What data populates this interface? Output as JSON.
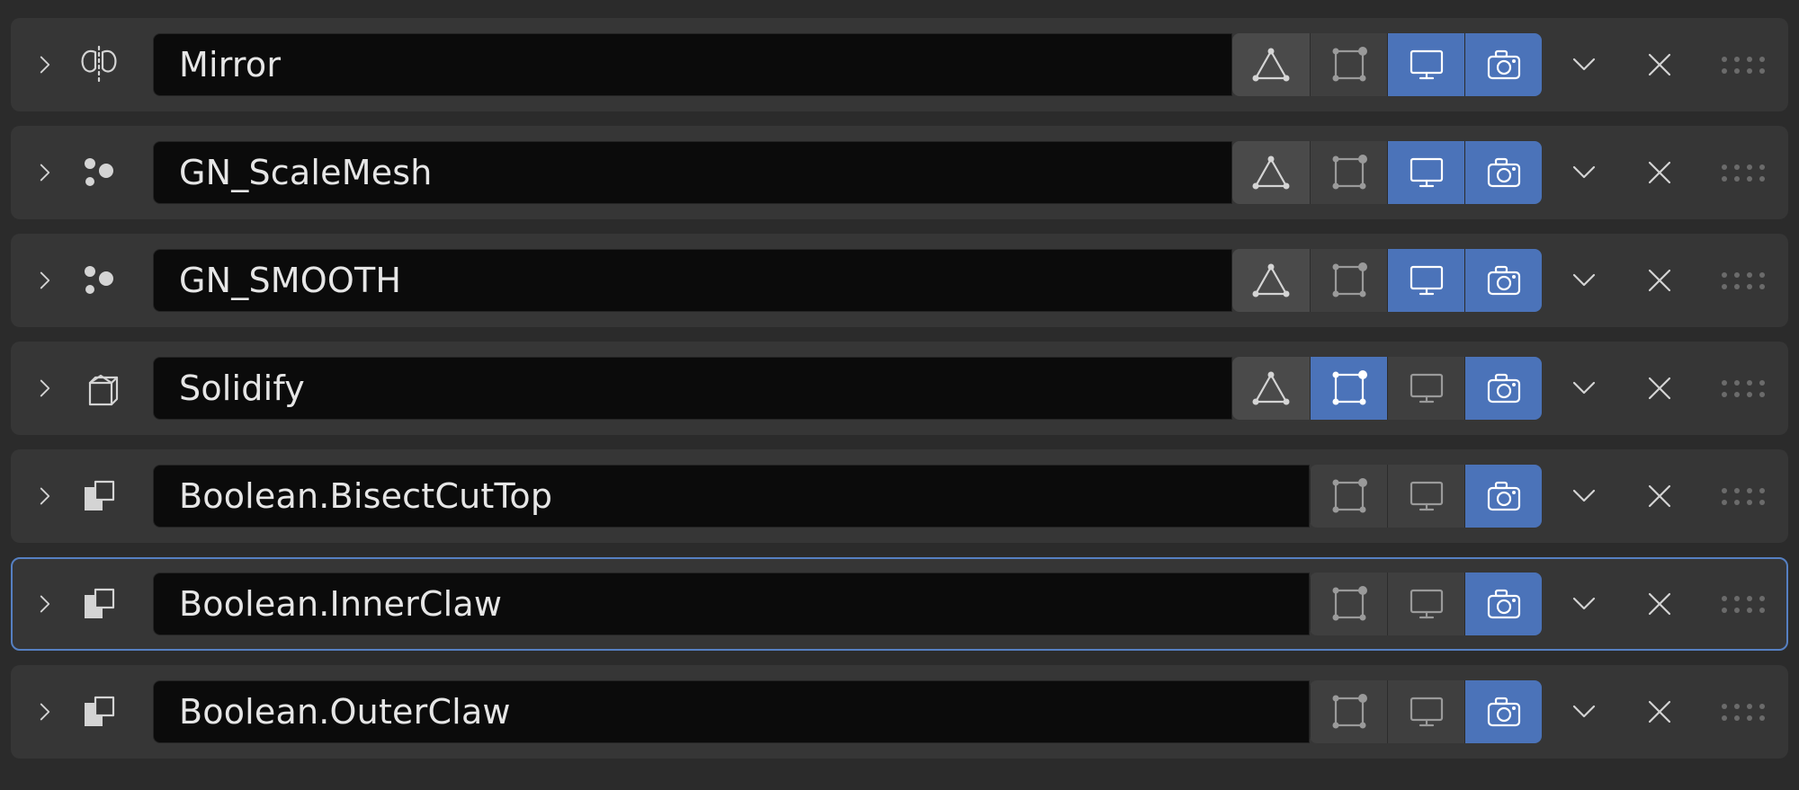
{
  "modifiers": [
    {
      "name": "Mirror",
      "type_icon": "mirror",
      "selected": false,
      "toggles": {
        "on_cage": {
          "show": true,
          "state": "off"
        },
        "edit_mode": {
          "show": true,
          "state": "dim"
        },
        "realtime": {
          "show": true,
          "state": "on"
        },
        "render": {
          "show": true,
          "state": "on"
        }
      }
    },
    {
      "name": "GN_ScaleMesh",
      "type_icon": "geometry-nodes",
      "selected": false,
      "toggles": {
        "on_cage": {
          "show": true,
          "state": "off"
        },
        "edit_mode": {
          "show": true,
          "state": "dim"
        },
        "realtime": {
          "show": true,
          "state": "on"
        },
        "render": {
          "show": true,
          "state": "on"
        }
      }
    },
    {
      "name": "GN_SMOOTH",
      "type_icon": "geometry-nodes",
      "selected": false,
      "toggles": {
        "on_cage": {
          "show": true,
          "state": "off"
        },
        "edit_mode": {
          "show": true,
          "state": "dim"
        },
        "realtime": {
          "show": true,
          "state": "on"
        },
        "render": {
          "show": true,
          "state": "on"
        }
      }
    },
    {
      "name": "Solidify",
      "type_icon": "solidify",
      "selected": false,
      "toggles": {
        "on_cage": {
          "show": true,
          "state": "off"
        },
        "edit_mode": {
          "show": true,
          "state": "on"
        },
        "realtime": {
          "show": true,
          "state": "dim"
        },
        "render": {
          "show": true,
          "state": "on"
        }
      }
    },
    {
      "name": "Boolean.BisectCutTop",
      "type_icon": "boolean",
      "selected": false,
      "toggles": {
        "on_cage": {
          "show": false,
          "state": "off"
        },
        "edit_mode": {
          "show": true,
          "state": "dim"
        },
        "realtime": {
          "show": true,
          "state": "dim"
        },
        "render": {
          "show": true,
          "state": "on"
        }
      }
    },
    {
      "name": "Boolean.InnerClaw",
      "type_icon": "boolean",
      "selected": true,
      "toggles": {
        "on_cage": {
          "show": false,
          "state": "off"
        },
        "edit_mode": {
          "show": true,
          "state": "dim"
        },
        "realtime": {
          "show": true,
          "state": "dim"
        },
        "render": {
          "show": true,
          "state": "on"
        }
      }
    },
    {
      "name": "Boolean.OuterClaw",
      "type_icon": "boolean",
      "selected": false,
      "toggles": {
        "on_cage": {
          "show": false,
          "state": "off"
        },
        "edit_mode": {
          "show": true,
          "state": "dim"
        },
        "realtime": {
          "show": true,
          "state": "dim"
        },
        "render": {
          "show": true,
          "state": "on"
        }
      }
    }
  ],
  "icon_labels": {
    "on_cage": "on-cage-icon",
    "edit_mode": "edit-mode-icon",
    "realtime": "realtime-icon",
    "render": "render-icon"
  }
}
